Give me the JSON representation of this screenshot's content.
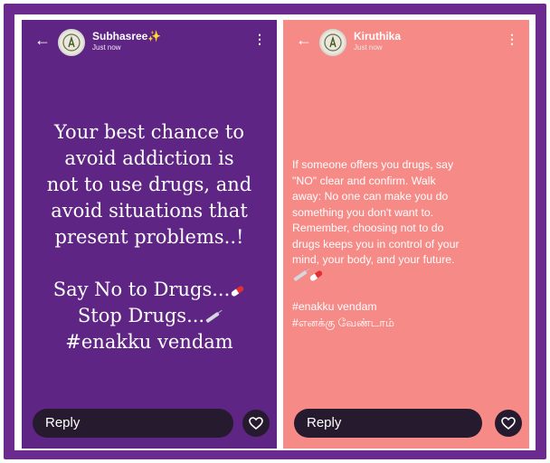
{
  "colors": {
    "frame": "#6a2a8e",
    "left_bg": "#5f2585",
    "right_bg": "#f58a86",
    "reply_bg": "#261a2e"
  },
  "left_story": {
    "user_name": "Subhasree✨",
    "timestamp": "Just now",
    "back_icon": "←",
    "more_icon": "⋮",
    "body_lines": [
      "Your best chance to",
      "avoid addiction is",
      "not to use drugs, and",
      "avoid situations that",
      "present problems..!"
    ],
    "line_say_no": "Say No to Drugs...",
    "line_stop": "Stop Drugs...",
    "line_hashtag": "#enakku vendam",
    "reply_label": "Reply"
  },
  "right_story": {
    "user_name": "Kiruthika",
    "timestamp": "Just now",
    "back_icon": "←",
    "more_icon": "⋮",
    "body_lines": [
      "If someone offers you drugs, say",
      "\"NO\" clear and confirm. Walk",
      "away: No one can make you do",
      "something you don't want to.",
      "Remember, choosing not to do",
      "drugs keeps you in control of your",
      "mind, your body, and your future."
    ],
    "hashtag_1": "#enakku vendam",
    "hashtag_2": "#எனக்கு வேண்டாம்",
    "reply_label": "Reply"
  }
}
